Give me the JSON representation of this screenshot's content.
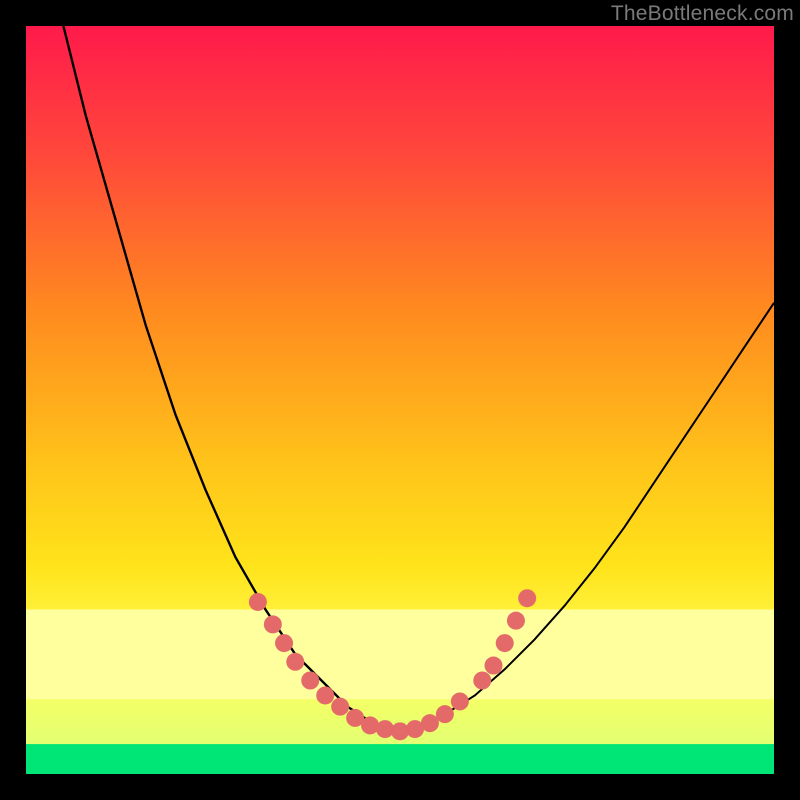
{
  "watermark": "TheBottleneck.com",
  "chart_data": {
    "type": "line",
    "title": "",
    "xlabel": "",
    "ylabel": "",
    "xlim": [
      0,
      100
    ],
    "ylim": [
      0,
      100
    ],
    "grid": false,
    "legend": false,
    "background_gradient": {
      "top": "#ff1a4b",
      "upper_mid": "#ff8a1f",
      "mid": "#ffe31a",
      "lower_mid": "#f7ff52",
      "green_band": "#00ff77",
      "bottom": "#00e676"
    },
    "overlay_bands": [
      {
        "name": "pale-yellow-band",
        "y_top": 78,
        "y_bottom": 90,
        "color": "#ffff9e"
      },
      {
        "name": "green-band",
        "y_top": 96,
        "y_bottom": 100,
        "color": "#00e676"
      }
    ],
    "series": [
      {
        "name": "left-curve",
        "type": "line",
        "color": "#000000",
        "x": [
          5,
          8,
          12,
          16,
          20,
          24,
          28,
          32,
          36,
          40,
          43,
          46,
          48,
          50
        ],
        "y": [
          0,
          12,
          26,
          40,
          52,
          62,
          71,
          78,
          84,
          88,
          91,
          93,
          94,
          94.5
        ]
      },
      {
        "name": "right-curve",
        "type": "line",
        "color": "#000000",
        "x": [
          50,
          53,
          56,
          60,
          64,
          68,
          72,
          76,
          80,
          84,
          88,
          92,
          96,
          100
        ],
        "y": [
          94.5,
          93.5,
          92,
          89.5,
          86,
          82,
          77.5,
          72.5,
          67,
          61,
          55,
          49,
          43,
          37
        ]
      }
    ],
    "markers": {
      "name": "bottom-dots",
      "color": "#e46a6a",
      "radius": 9,
      "points": [
        {
          "x": 31,
          "y": 77
        },
        {
          "x": 33,
          "y": 80
        },
        {
          "x": 34.5,
          "y": 82.5
        },
        {
          "x": 36,
          "y": 85
        },
        {
          "x": 38,
          "y": 87.5
        },
        {
          "x": 40,
          "y": 89.5
        },
        {
          "x": 42,
          "y": 91
        },
        {
          "x": 44,
          "y": 92.5
        },
        {
          "x": 46,
          "y": 93.5
        },
        {
          "x": 48,
          "y": 94
        },
        {
          "x": 50,
          "y": 94.3
        },
        {
          "x": 52,
          "y": 94
        },
        {
          "x": 54,
          "y": 93.2
        },
        {
          "x": 56,
          "y": 92
        },
        {
          "x": 58,
          "y": 90.3
        },
        {
          "x": 61,
          "y": 87.5
        },
        {
          "x": 62.5,
          "y": 85.5
        },
        {
          "x": 64,
          "y": 82.5
        },
        {
          "x": 65.5,
          "y": 79.5
        },
        {
          "x": 67,
          "y": 76.5
        }
      ]
    }
  }
}
